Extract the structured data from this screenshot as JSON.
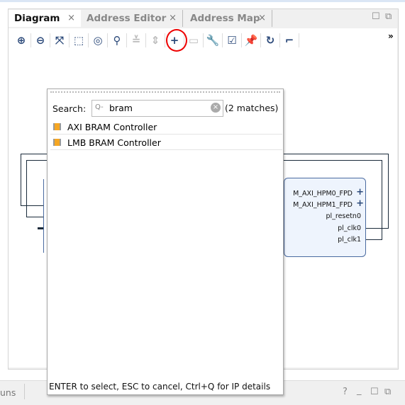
{
  "tabs": [
    {
      "label": "Diagram",
      "close": "×"
    },
    {
      "label": "Address Editor",
      "close": "×"
    },
    {
      "label": "Address Map",
      "close": "×"
    }
  ],
  "window_buttons": {
    "maximize": "☐",
    "float": "⧉"
  },
  "toolbar": {
    "icons": [
      "zoom-in",
      "zoom-out",
      "zoom-fit",
      "zoom-selection",
      "center",
      "search",
      "collapse",
      "expand",
      "add-ip",
      "add-module",
      "customize",
      "validate",
      "pin",
      "regenerate",
      "optimize-routing"
    ],
    "glyphs": [
      "⊕",
      "⊖",
      "⤧",
      "⬚",
      "◎",
      "⚲",
      "≚",
      "⇕",
      "+",
      "▭",
      "🔧",
      "☑",
      "📌",
      "↻",
      "⌐"
    ],
    "overflow": "»"
  },
  "ip_block": {
    "ports": [
      "M_AXI_HPM0_FPD",
      "M_AXI_HPM1_FPD",
      "pl_resetn0",
      "pl_clk0",
      "pl_clk1"
    ]
  },
  "popup": {
    "search_label": "Search:",
    "search_value": "bram",
    "search_icon": "Q-",
    "matches": "(2 matches)",
    "items": [
      "AXI BRAM Controller",
      "LMB BRAM Controller"
    ],
    "hint": "ENTER to select, ESC to cancel, Ctrl+Q for IP details"
  },
  "bottom_panel": {
    "tab_partial": "uns",
    "buttons": [
      "?",
      "_",
      "☐",
      "⧉"
    ]
  },
  "colors": {
    "accent": "#2c4a7a",
    "highlight_circle": "#e00000",
    "ip_icon": "#f5a623"
  }
}
